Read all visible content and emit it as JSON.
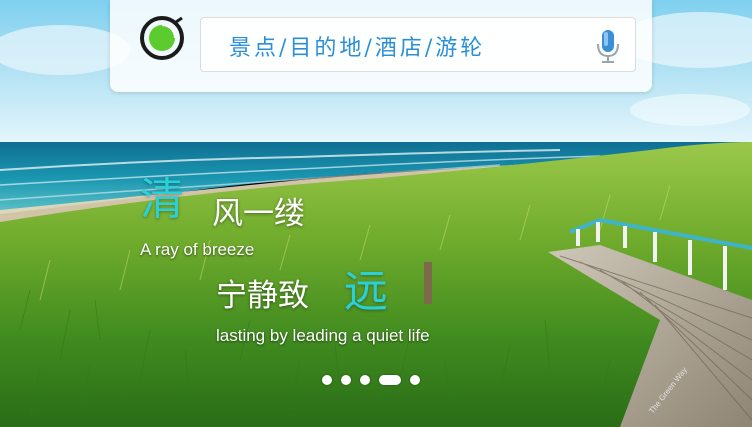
{
  "search": {
    "placeholder": "景点/目的地/酒店/游轮",
    "logo_icon": "camera-lens-logo-icon",
    "mic_icon": "microphone-icon"
  },
  "slogan": {
    "highlight_char_1": "清",
    "line_1_rest": "风一缕",
    "line_1_en": "A ray of breeze",
    "line_2_lead": "宁静致",
    "highlight_char_2": "远",
    "line_2_en": "lasting by leading a quiet life"
  },
  "pager": {
    "total": 5,
    "active_index": 3
  },
  "watermark": "The Green Way",
  "colors": {
    "accent_teal": "#29d0d8",
    "search_text": "#2b8fd6",
    "logo_green": "#5ccb2e"
  }
}
